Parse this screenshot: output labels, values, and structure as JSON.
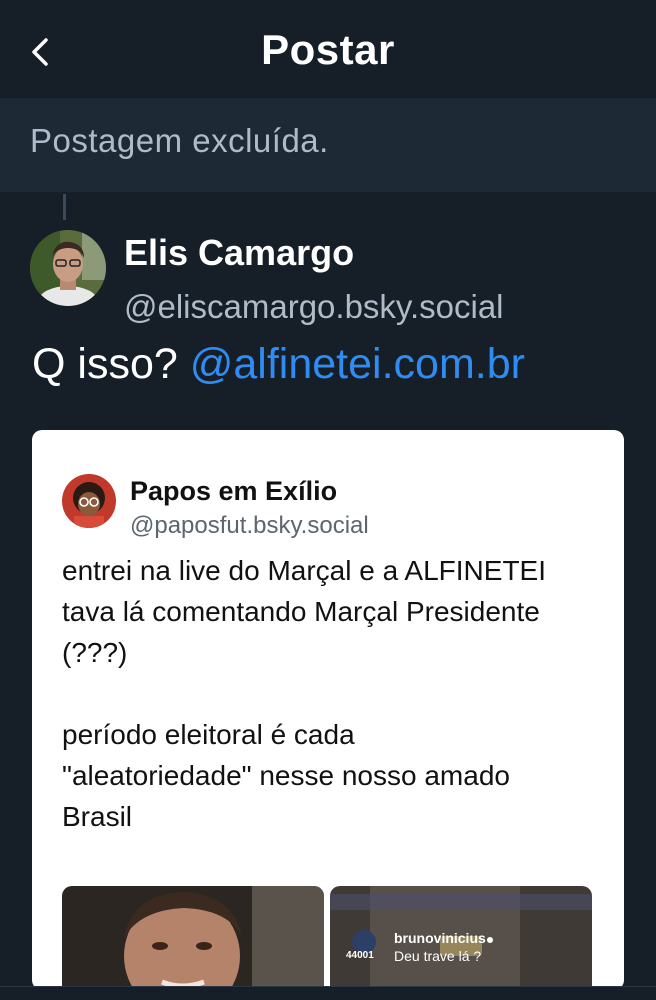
{
  "header": {
    "title": "Postar",
    "back_icon": "chevron-left-icon"
  },
  "deleted_banner": {
    "text": "Postagem excluída."
  },
  "post": {
    "author_name": "Elis Camargo",
    "author_handle": "@eliscamargo.bsky.social",
    "text_plain": "Q isso? ",
    "text_mention": "@alfinetei.com.br"
  },
  "embed": {
    "author_name": "Papos em Exílio",
    "author_handle": "@paposfut.bsky.social",
    "text": "entrei na live do Marçal e a ALFINETEI\ntava lá comentando Marçal Presidente\n(???)\n\nperíodo eleitoral é cada\n\"aleatoriedade\" nesse nosso amado\nBrasil",
    "media": {
      "right_username": "brunovinicius",
      "right_comment": "Deu trave lá ?",
      "right_count": "44001"
    }
  },
  "colors": {
    "background": "#161e27",
    "banner": "#1e2936",
    "muted_text": "#aebbc9",
    "link": "#2f8cf3"
  }
}
